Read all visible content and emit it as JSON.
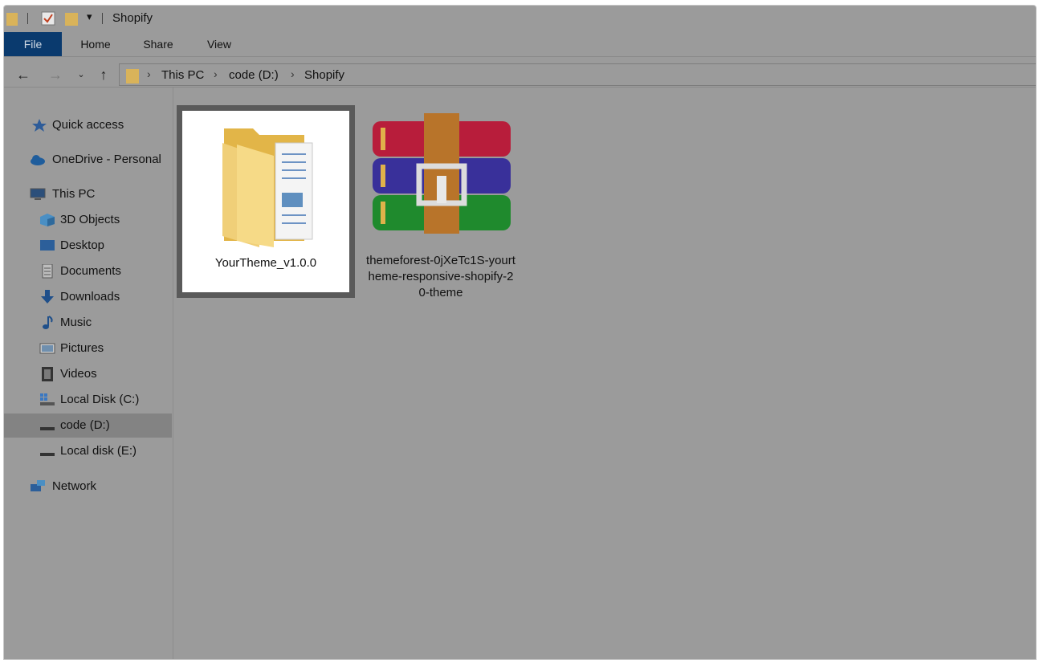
{
  "window": {
    "title": "Shopify"
  },
  "ribbon": {
    "tabs": [
      "File",
      "Home",
      "Share",
      "View"
    ]
  },
  "address": {
    "crumbs": [
      "This PC",
      "code (D:)",
      "Shopify"
    ]
  },
  "sidebar": {
    "quick_access": "Quick access",
    "onedrive": "OneDrive - Personal",
    "this_pc": "This PC",
    "items": [
      "3D Objects",
      "Desktop",
      "Documents",
      "Downloads",
      "Music",
      "Pictures",
      "Videos",
      "Local Disk (C:)",
      "code (D:)",
      "Local disk (E:)"
    ],
    "network": "Network",
    "selected": "code (D:)"
  },
  "files": [
    {
      "name": "YourTheme_v1.0.0",
      "type": "folder",
      "selected": true
    },
    {
      "name": "themeforest-0jXeTc1S-yourtheme-responsive-shopify-20-theme",
      "type": "rar-archive",
      "selected": false
    }
  ],
  "colors": {
    "file_tab": "#0a3a6e",
    "background_dim": "#9b9b9b",
    "folder": "#e8b84a"
  }
}
